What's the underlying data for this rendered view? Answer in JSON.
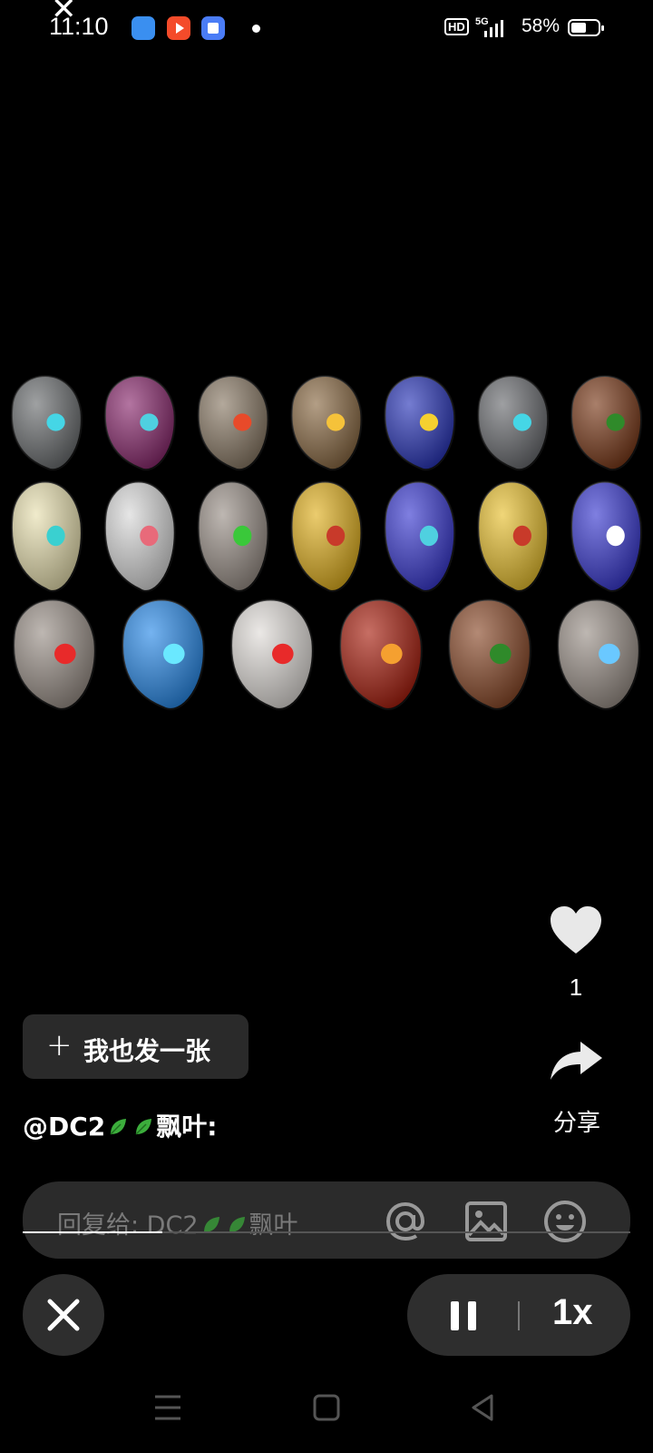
{
  "status_bar": {
    "time": "11:10",
    "hd_badge": "HD",
    "network_label": "5G",
    "battery_pct": "58%",
    "battery_level": 0.58,
    "app_icons": [
      "blue-app-icon",
      "video-app-icon",
      "blue-square-app-icon"
    ]
  },
  "actions": {
    "like_count": "1",
    "share_label": "分享"
  },
  "post_button": {
    "plus": "+",
    "label": "我也发一张"
  },
  "author": {
    "prefix": "@DC2",
    "suffix": "飘叶:"
  },
  "reply": {
    "placeholder_prefix": "回复给: DC2",
    "placeholder_suffix": "飘叶"
  },
  "playback": {
    "progress": 0.23,
    "speed_label": "1x"
  },
  "colors": {
    "background": "#000000",
    "pill": "#2e2e2e",
    "leaf": "#3cae3c"
  }
}
